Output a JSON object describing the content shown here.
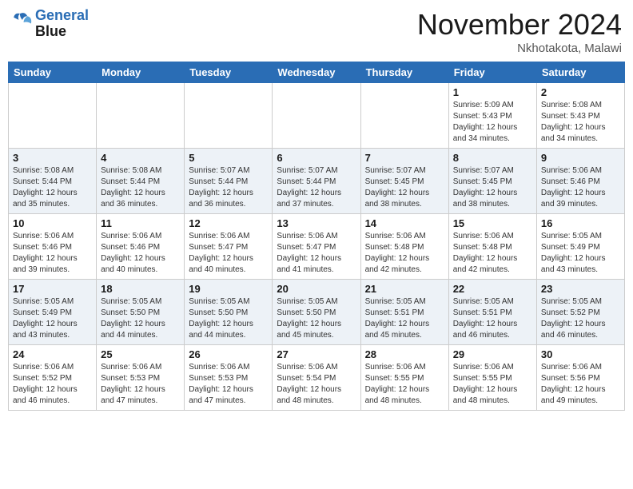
{
  "header": {
    "logo_line1": "General",
    "logo_line2": "Blue",
    "month": "November 2024",
    "location": "Nkhotakota, Malawi"
  },
  "weekdays": [
    "Sunday",
    "Monday",
    "Tuesday",
    "Wednesday",
    "Thursday",
    "Friday",
    "Saturday"
  ],
  "weeks": [
    [
      {
        "day": "",
        "info": ""
      },
      {
        "day": "",
        "info": ""
      },
      {
        "day": "",
        "info": ""
      },
      {
        "day": "",
        "info": ""
      },
      {
        "day": "",
        "info": ""
      },
      {
        "day": "1",
        "info": "Sunrise: 5:09 AM\nSunset: 5:43 PM\nDaylight: 12 hours\nand 34 minutes."
      },
      {
        "day": "2",
        "info": "Sunrise: 5:08 AM\nSunset: 5:43 PM\nDaylight: 12 hours\nand 34 minutes."
      }
    ],
    [
      {
        "day": "3",
        "info": "Sunrise: 5:08 AM\nSunset: 5:44 PM\nDaylight: 12 hours\nand 35 minutes."
      },
      {
        "day": "4",
        "info": "Sunrise: 5:08 AM\nSunset: 5:44 PM\nDaylight: 12 hours\nand 36 minutes."
      },
      {
        "day": "5",
        "info": "Sunrise: 5:07 AM\nSunset: 5:44 PM\nDaylight: 12 hours\nand 36 minutes."
      },
      {
        "day": "6",
        "info": "Sunrise: 5:07 AM\nSunset: 5:44 PM\nDaylight: 12 hours\nand 37 minutes."
      },
      {
        "day": "7",
        "info": "Sunrise: 5:07 AM\nSunset: 5:45 PM\nDaylight: 12 hours\nand 38 minutes."
      },
      {
        "day": "8",
        "info": "Sunrise: 5:07 AM\nSunset: 5:45 PM\nDaylight: 12 hours\nand 38 minutes."
      },
      {
        "day": "9",
        "info": "Sunrise: 5:06 AM\nSunset: 5:46 PM\nDaylight: 12 hours\nand 39 minutes."
      }
    ],
    [
      {
        "day": "10",
        "info": "Sunrise: 5:06 AM\nSunset: 5:46 PM\nDaylight: 12 hours\nand 39 minutes."
      },
      {
        "day": "11",
        "info": "Sunrise: 5:06 AM\nSunset: 5:46 PM\nDaylight: 12 hours\nand 40 minutes."
      },
      {
        "day": "12",
        "info": "Sunrise: 5:06 AM\nSunset: 5:47 PM\nDaylight: 12 hours\nand 40 minutes."
      },
      {
        "day": "13",
        "info": "Sunrise: 5:06 AM\nSunset: 5:47 PM\nDaylight: 12 hours\nand 41 minutes."
      },
      {
        "day": "14",
        "info": "Sunrise: 5:06 AM\nSunset: 5:48 PM\nDaylight: 12 hours\nand 42 minutes."
      },
      {
        "day": "15",
        "info": "Sunrise: 5:06 AM\nSunset: 5:48 PM\nDaylight: 12 hours\nand 42 minutes."
      },
      {
        "day": "16",
        "info": "Sunrise: 5:05 AM\nSunset: 5:49 PM\nDaylight: 12 hours\nand 43 minutes."
      }
    ],
    [
      {
        "day": "17",
        "info": "Sunrise: 5:05 AM\nSunset: 5:49 PM\nDaylight: 12 hours\nand 43 minutes."
      },
      {
        "day": "18",
        "info": "Sunrise: 5:05 AM\nSunset: 5:50 PM\nDaylight: 12 hours\nand 44 minutes."
      },
      {
        "day": "19",
        "info": "Sunrise: 5:05 AM\nSunset: 5:50 PM\nDaylight: 12 hours\nand 44 minutes."
      },
      {
        "day": "20",
        "info": "Sunrise: 5:05 AM\nSunset: 5:50 PM\nDaylight: 12 hours\nand 45 minutes."
      },
      {
        "day": "21",
        "info": "Sunrise: 5:05 AM\nSunset: 5:51 PM\nDaylight: 12 hours\nand 45 minutes."
      },
      {
        "day": "22",
        "info": "Sunrise: 5:05 AM\nSunset: 5:51 PM\nDaylight: 12 hours\nand 46 minutes."
      },
      {
        "day": "23",
        "info": "Sunrise: 5:05 AM\nSunset: 5:52 PM\nDaylight: 12 hours\nand 46 minutes."
      }
    ],
    [
      {
        "day": "24",
        "info": "Sunrise: 5:06 AM\nSunset: 5:52 PM\nDaylight: 12 hours\nand 46 minutes."
      },
      {
        "day": "25",
        "info": "Sunrise: 5:06 AM\nSunset: 5:53 PM\nDaylight: 12 hours\nand 47 minutes."
      },
      {
        "day": "26",
        "info": "Sunrise: 5:06 AM\nSunset: 5:53 PM\nDaylight: 12 hours\nand 47 minutes."
      },
      {
        "day": "27",
        "info": "Sunrise: 5:06 AM\nSunset: 5:54 PM\nDaylight: 12 hours\nand 48 minutes."
      },
      {
        "day": "28",
        "info": "Sunrise: 5:06 AM\nSunset: 5:55 PM\nDaylight: 12 hours\nand 48 minutes."
      },
      {
        "day": "29",
        "info": "Sunrise: 5:06 AM\nSunset: 5:55 PM\nDaylight: 12 hours\nand 48 minutes."
      },
      {
        "day": "30",
        "info": "Sunrise: 5:06 AM\nSunset: 5:56 PM\nDaylight: 12 hours\nand 49 minutes."
      }
    ]
  ]
}
